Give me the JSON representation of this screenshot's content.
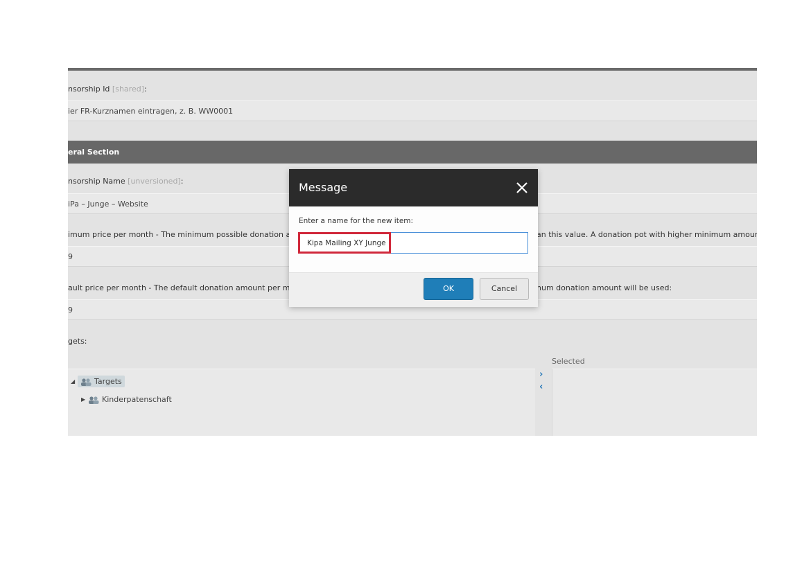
{
  "form": {
    "sponsorship_id": {
      "label": "nsorship Id",
      "tag": "[shared]",
      "colon": ":",
      "value": "ier FR-Kurznamen eintragen, z. B. WW0001"
    },
    "section_header": "eral Section",
    "sponsorship_name": {
      "label": "nsorship Name",
      "tag": "[unversioned]",
      "colon": ":",
      "value": "iPa – Junge –  Website"
    },
    "min_price": {
      "label_left": "imum price per month - The minimum possible donation amou",
      "label_right": "an this value. A donation pot with higher minimum amount wou",
      "value": "9"
    },
    "default_price": {
      "label_left": "ault price per month - The default donation amount per month i",
      "label_right": "num donation amount will be used:",
      "value": "9"
    },
    "targets": {
      "label": "gets:",
      "selected_label": "Selected",
      "tree": [
        {
          "label": "Targets",
          "expanded": true
        },
        {
          "label": "Kinderpatenschaft",
          "expanded": false
        }
      ],
      "add_icon": "chevron-right-icon",
      "remove_icon": "chevron-left-icon"
    }
  },
  "dialog": {
    "title": "Message",
    "prompt": "Enter a name for the new item:",
    "input_value": "Kipa Mailing XY Junge",
    "ok_label": "OK",
    "cancel_label": "Cancel",
    "close_icon": "close-icon"
  },
  "colors": {
    "dialog_header": "#2b2b2b",
    "section_header": "#686868",
    "ok_button": "#1f7eb8",
    "highlight": "#d0283a",
    "arrows": "#2b7bb9"
  }
}
